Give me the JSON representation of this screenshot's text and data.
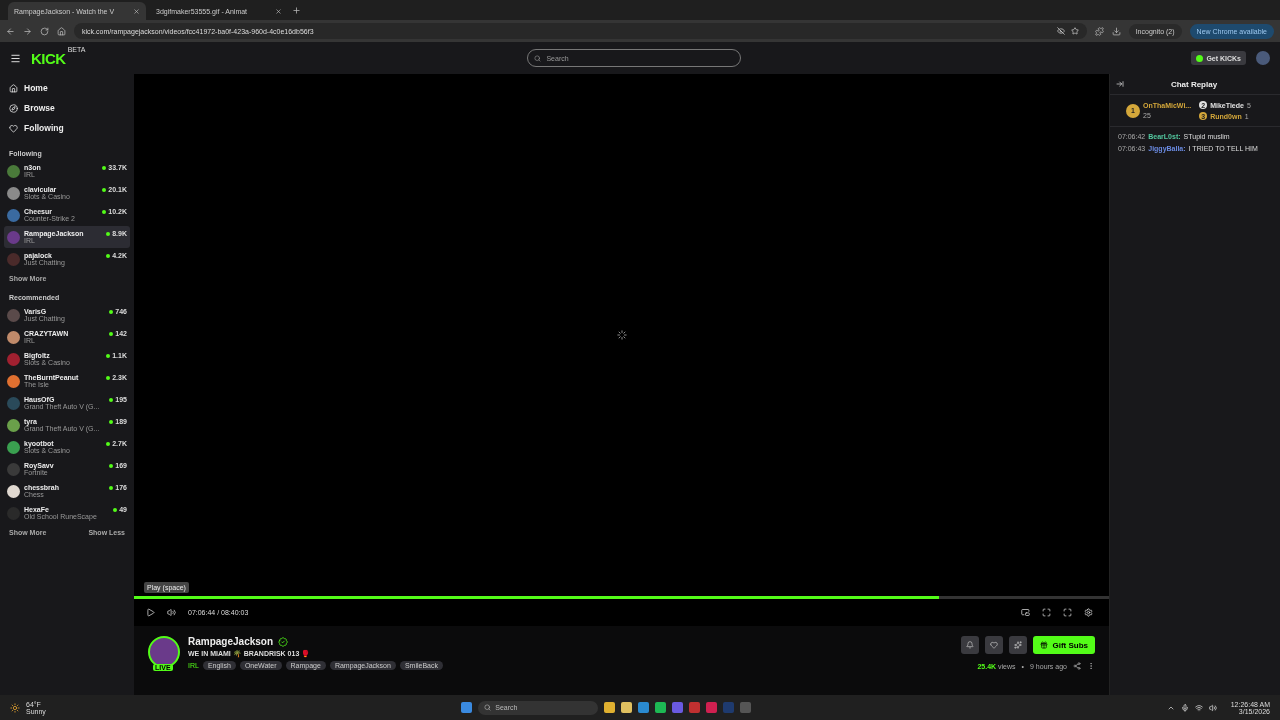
{
  "browser": {
    "tabs": [
      {
        "title": "RampageJackson - Watch the V",
        "selected": true
      },
      {
        "title": "3dgifmaker53555.gif - Animat",
        "selected": false
      }
    ],
    "url": "kick.com/rampagejackson/videos/fcc41972-ba0f-423a-960d-4c0e16db56f3",
    "incognito": "Incognito (2)",
    "update": "New Chrome available"
  },
  "header": {
    "logo": "KICK",
    "logo_badge": "BETA",
    "search_placeholder": "Search",
    "get_kicks": "Get KICKs"
  },
  "nav": [
    {
      "label": "Home"
    },
    {
      "label": "Browse"
    },
    {
      "label": "Following"
    }
  ],
  "sections": [
    {
      "title": "Following",
      "channels": [
        {
          "name": "n3on",
          "category": "IRL",
          "viewers": "33.7K",
          "selected": false,
          "color": "#4a7a3a"
        },
        {
          "name": "clavicular",
          "category": "Slots & Casino",
          "viewers": "20.1K",
          "selected": false,
          "color": "#8a8a8a"
        },
        {
          "name": "Cheesur",
          "category": "Counter-Strike 2",
          "viewers": "10.2K",
          "selected": false,
          "color": "#3a6aa0"
        },
        {
          "name": "RampageJackson",
          "category": "IRL",
          "viewers": "8.9K",
          "selected": true,
          "color": "#6a3a8a"
        },
        {
          "name": "pajalock",
          "category": "Just Chatting",
          "viewers": "4.2K",
          "selected": false,
          "color": "#4a2a2a"
        }
      ],
      "more": [
        "Show More"
      ]
    },
    {
      "title": "Recommended",
      "channels": [
        {
          "name": "VarisG",
          "category": "Just Chatting",
          "viewers": "746",
          "selected": false,
          "color": "#5a4a4a"
        },
        {
          "name": "CRAZYTAWN",
          "category": "IRL",
          "viewers": "142",
          "selected": false,
          "color": "#c08a6a"
        },
        {
          "name": "Bigfoltz",
          "category": "Slots & Casino",
          "viewers": "1.1K",
          "selected": false,
          "color": "#a02030"
        },
        {
          "name": "TheBurntPeanut",
          "category": "The Isle",
          "viewers": "2.3K",
          "selected": false,
          "color": "#e07030"
        },
        {
          "name": "HausOfG",
          "category": "Grand Theft Auto V (G...",
          "viewers": "195",
          "selected": false,
          "color": "#2a4a5a"
        },
        {
          "name": "tyra",
          "category": "Grand Theft Auto V (G...",
          "viewers": "189",
          "selected": false,
          "color": "#6aa04a"
        },
        {
          "name": "kyootbot",
          "category": "Slots & Casino",
          "viewers": "2.7K",
          "selected": false,
          "color": "#3aa050"
        },
        {
          "name": "RoySavv",
          "category": "Fortnite",
          "viewers": "169",
          "selected": false,
          "color": "#3a3a3a"
        },
        {
          "name": "chessbrah",
          "category": "Chess",
          "viewers": "176",
          "selected": false,
          "color": "#e0d8d0"
        },
        {
          "name": "HexaFe",
          "category": "Old School RuneScape",
          "viewers": "49",
          "selected": false,
          "color": "#2a2a2a"
        }
      ],
      "more": [
        "Show More",
        "Show Less"
      ]
    }
  ],
  "player": {
    "tooltip": "Play (space)",
    "time": "07:06:44 / 08:40:03",
    "level": 0.826
  },
  "streamer": {
    "name": "RampageJackson",
    "verified": true,
    "live_badge": "LIVE",
    "title": "WE IN MIAMI 🌴 BRANDRISK 013 🥊",
    "category": "IRL",
    "tags": [
      "English",
      "OneWater",
      "Rampage",
      "RampageJackson",
      "SmileBack"
    ],
    "gift": "Gift Subs",
    "views": "25.4K",
    "views_label": "views",
    "separator": "•",
    "age": "9 hours ago"
  },
  "chat": {
    "title": "Chat Replay",
    "leaders": [
      {
        "rank": "1",
        "name": "OnThaMicWi...",
        "count": "25",
        "color": "#d4a73a"
      },
      {
        "rank": "2",
        "name": "MikeTiede",
        "count": "5",
        "color": "#e0e0e0"
      },
      {
        "rank": "3",
        "name": "Rund0wn",
        "count": "1",
        "color": "#d4a73a"
      }
    ],
    "messages": [
      {
        "time": "07:06:42",
        "user": "BearL0st:",
        "text": "STupid muslim",
        "color": "#53c9a0"
      },
      {
        "time": "07:06:43",
        "user": "JiggyBalla:",
        "text": "I TRIED TO TELL HIM",
        "color": "#6a8ae0"
      }
    ]
  },
  "taskbar": {
    "weather": "64°F",
    "condition": "Sunny",
    "search": "Search",
    "time": "12:26:48 AM",
    "date": "3/15/2026"
  }
}
